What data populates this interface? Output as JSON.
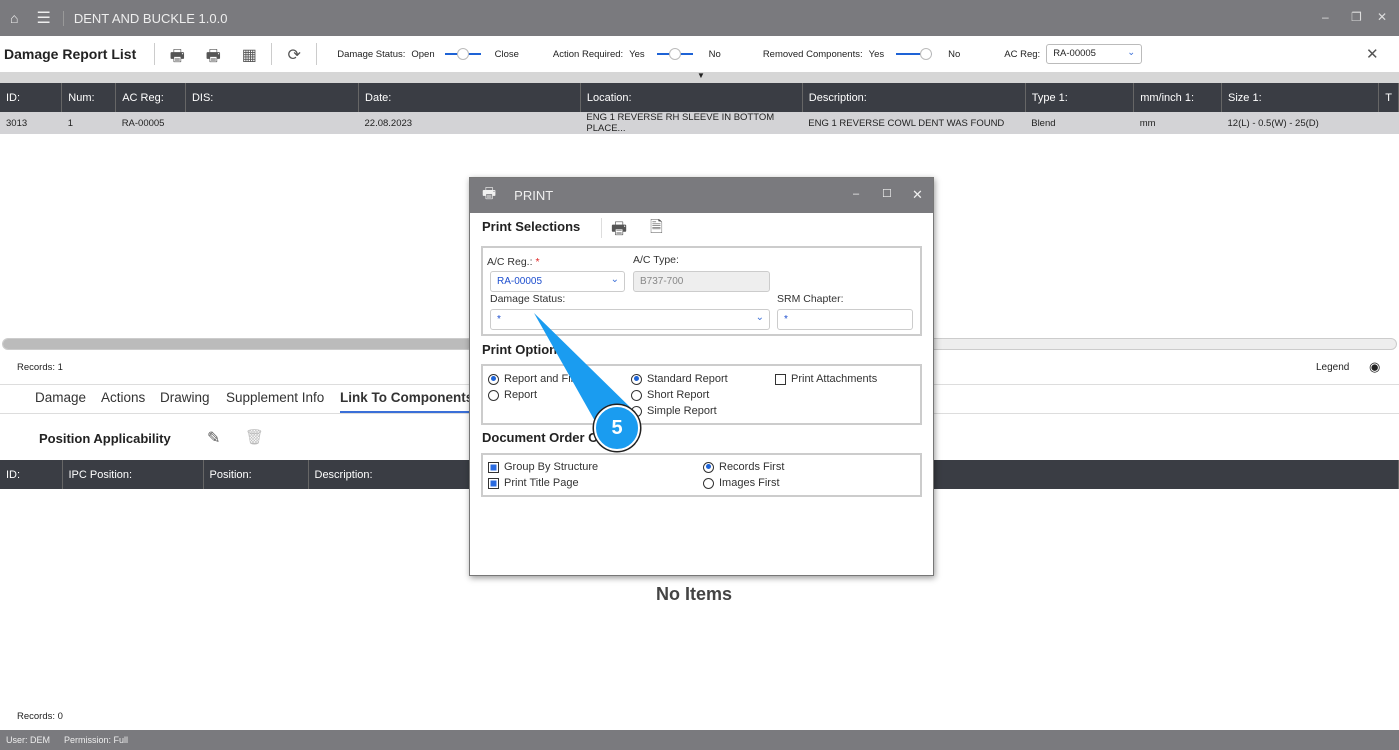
{
  "app": {
    "title": "DENT AND BUCKLE 1.0.0",
    "minimize": "‒",
    "restore": "❐",
    "close": "✕"
  },
  "toolbar": {
    "title": "Damage Report List",
    "damage_status_label": "Damage Status:",
    "open": "Open",
    "close": "Close",
    "action_required_label": "Action Required:",
    "yes": "Yes",
    "no": "No",
    "removed_components_label": "Removed Components:",
    "ac_reg_label": "AC Reg:",
    "ac_reg_value": "RA-00005",
    "close_x": "✕"
  },
  "table": {
    "headers": [
      "ID:",
      "Num:",
      "AC Reg:",
      "DIS:",
      "Date:",
      "Location:",
      "Description:",
      "Type 1:",
      "mm/inch 1:",
      "Size 1:",
      "T"
    ],
    "rows": [
      [
        "3013",
        "1",
        "RA-00005",
        "",
        "22.08.2023",
        "ENG 1 REVERSE RH SLEEVE IN BOTTOM PLACE...",
        "ENG 1 REVERSE COWL DENT WAS FOUND",
        "Blend",
        "mm",
        "12(L) - 0.5(W) - 25(D)",
        ""
      ]
    ]
  },
  "records_top": "Records: 1",
  "legend": "Legend",
  "tabs": [
    "Damage",
    "Actions",
    "Drawing",
    "Supplement Info",
    "Link To Components"
  ],
  "position": {
    "title": "Position Applicability",
    "headers": [
      "ID:",
      "IPC Position:",
      "Position:",
      "Description:"
    ],
    "empty": "No Items"
  },
  "records_bottom": "Records: 0",
  "status": {
    "user": "User: DEM",
    "permission": "Permission: Full"
  },
  "dialog": {
    "title": "PRINT",
    "print_selections": "Print Selections",
    "ac_reg_label": "A/C Reg.:",
    "required": "*",
    "ac_reg_value": "RA-00005",
    "ac_type_label": "A/C Type:",
    "ac_type_value": "B737-700",
    "damage_status_label": "Damage Status:",
    "damage_status_value": "*",
    "srm_label": "SRM Chapter:",
    "srm_value": "*",
    "print_options": "Print Options",
    "report_and": "Report and Files",
    "report": "Report",
    "standard": "Standard Report",
    "short": "Short Report",
    "simple": "Simple Report",
    "attachments": "Print Attachments",
    "doc_order": "Document Order Options",
    "group": "Group By Structure",
    "title_page": "Print Title Page",
    "records_first": "Records First",
    "images_first": "Images First"
  },
  "callout": {
    "number": "5",
    "color": "#1a9cf0"
  }
}
